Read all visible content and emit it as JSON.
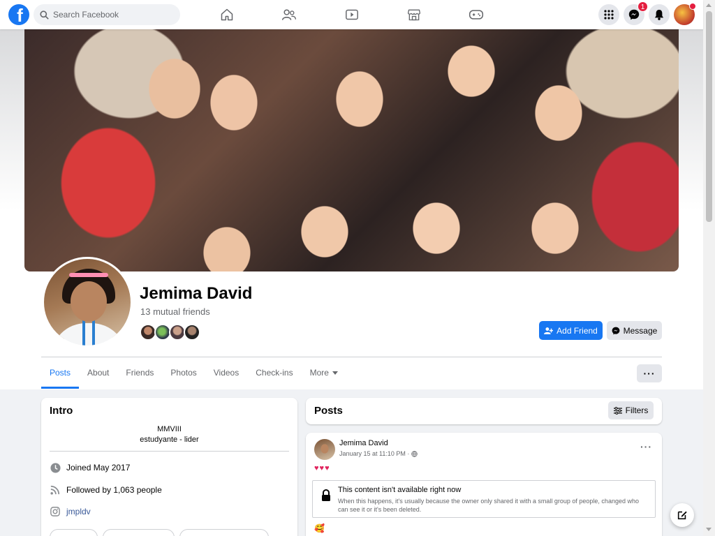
{
  "topnav": {
    "search_placeholder": "Search Facebook",
    "messenger_badge": "1",
    "brand_color": "#1877f2"
  },
  "profile": {
    "name": "Jemima David",
    "mutual_friends": "13 mutual friends",
    "add_friend_label": "Add Friend",
    "message_label": "Message"
  },
  "tabs": [
    {
      "label": "Posts"
    },
    {
      "label": "About"
    },
    {
      "label": "Friends"
    },
    {
      "label": "Photos"
    },
    {
      "label": "Videos"
    },
    {
      "label": "Check-ins"
    },
    {
      "label": "More"
    }
  ],
  "more_options_label": "···",
  "intro": {
    "title": "Intro",
    "bio_line1": "MMVIII",
    "bio_line2": "estudyante - lider",
    "joined": "Joined May 2017",
    "followed_prefix": "Followed by ",
    "followed_count": "1,063",
    "followed_suffix": " people",
    "instagram": "jmpldv"
  },
  "posts_header": {
    "title": "Posts",
    "filters_label": "Filters"
  },
  "post": {
    "author": "Jemima David",
    "time": "January 15 at 11:10 PM ·",
    "text": "♥♥♥",
    "menu": "···",
    "unavailable_title": "This content isn't available right now",
    "unavailable_body": "When this happens, it's usually because the owner only shared it with a small group of people, changed who can see it or it's been deleted.",
    "reaction": "🥰"
  }
}
